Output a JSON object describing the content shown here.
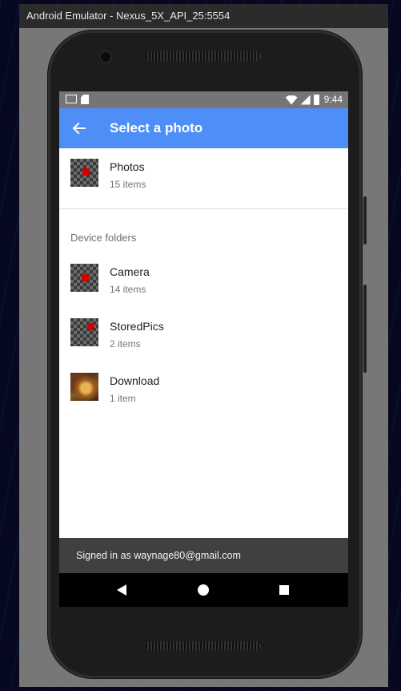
{
  "window": {
    "title": "Android Emulator - Nexus_5X_API_25:5554"
  },
  "status_bar": {
    "time": "9:44",
    "left_icons": [
      "mail-icon",
      "sd-card-icon"
    ],
    "right_icons": [
      "wifi-icon",
      "signal-icon",
      "battery-icon"
    ]
  },
  "app_bar": {
    "title": "Select a photo",
    "back_icon": "arrow-left-icon",
    "color": "#4d8ef7"
  },
  "albums": [
    {
      "name": "Photos",
      "count": "15 items",
      "thumbnail": "checker-red-dot"
    }
  ],
  "device_folders": {
    "header": "Device folders",
    "items": [
      {
        "name": "Camera",
        "count": "14 items",
        "thumbnail": "checker-red-dot"
      },
      {
        "name": "StoredPics",
        "count": "2 items",
        "thumbnail": "checker-red-dot"
      },
      {
        "name": "Download",
        "count": "1 item",
        "thumbnail": "photo"
      }
    ]
  },
  "footer": {
    "text": "Signed in as waynage80@gmail.com"
  },
  "nav_bar": {
    "icons": [
      "nav-back-icon",
      "nav-home-icon",
      "nav-recents-icon"
    ]
  }
}
